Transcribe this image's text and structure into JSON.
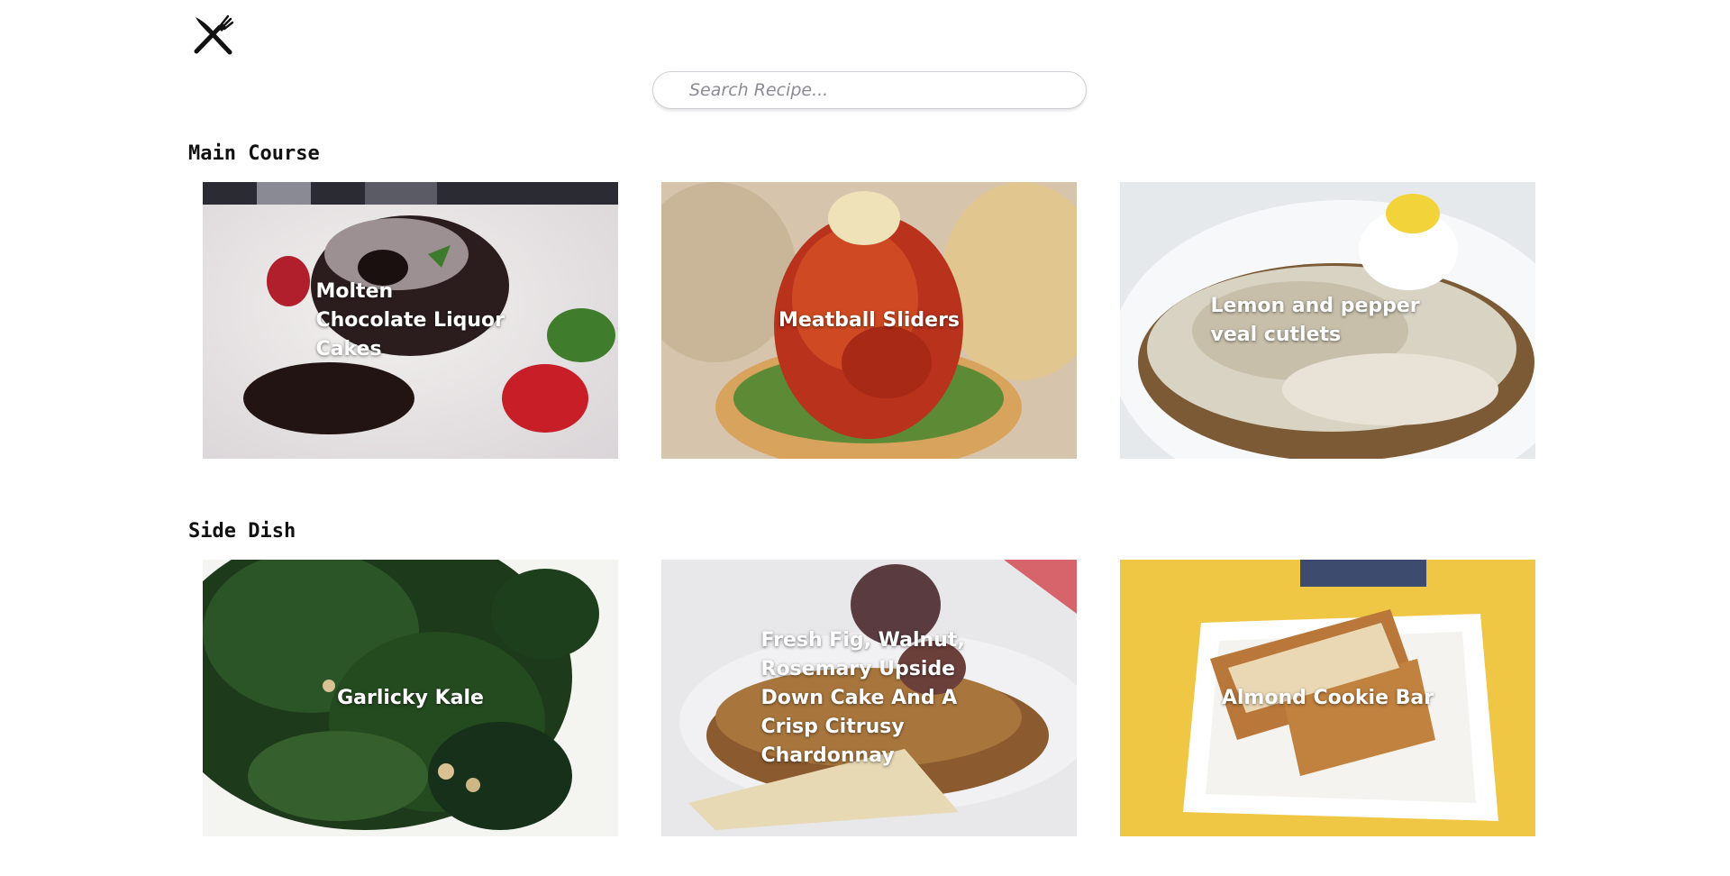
{
  "search": {
    "placeholder": "Search Recipe..."
  },
  "sections": [
    {
      "title": "Main Course",
      "cards": [
        {
          "title": "Molten Chocolate Liquor Cakes"
        },
        {
          "title": "Meatball Sliders"
        },
        {
          "title": "Lemon and pepper veal cutlets"
        }
      ]
    },
    {
      "title": "Side Dish",
      "cards": [
        {
          "title": "Garlicky Kale"
        },
        {
          "title": "Fresh Fig, Walnut, Rosemary Upside Down Cake And A Crisp Citrusy Chardonnay"
        },
        {
          "title": "Almond Cookie Bar"
        }
      ]
    }
  ],
  "colors": {
    "background": "#ffffff",
    "text": "#111111",
    "card_text": "#ffffff"
  },
  "icons": {
    "logo": "fork-knife-icon"
  }
}
